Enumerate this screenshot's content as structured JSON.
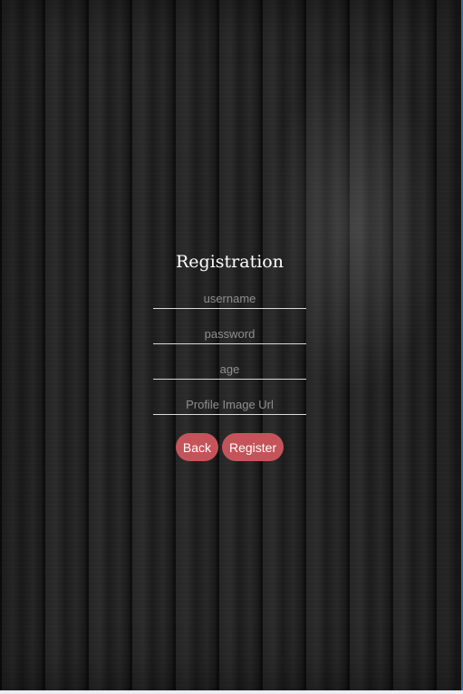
{
  "form": {
    "title": "Registration",
    "fields": {
      "username": {
        "placeholder": "username",
        "value": ""
      },
      "password": {
        "placeholder": "password",
        "value": ""
      },
      "age": {
        "placeholder": "age",
        "value": ""
      },
      "profile_image_url": {
        "placeholder": "Profile Image Url",
        "value": ""
      }
    },
    "buttons": {
      "back_label": "Back",
      "register_label": "Register"
    }
  },
  "colors": {
    "button": "#c4545a",
    "background": "#1f1f1f",
    "text": "#ffffff",
    "underline": "#d9d9d9"
  }
}
